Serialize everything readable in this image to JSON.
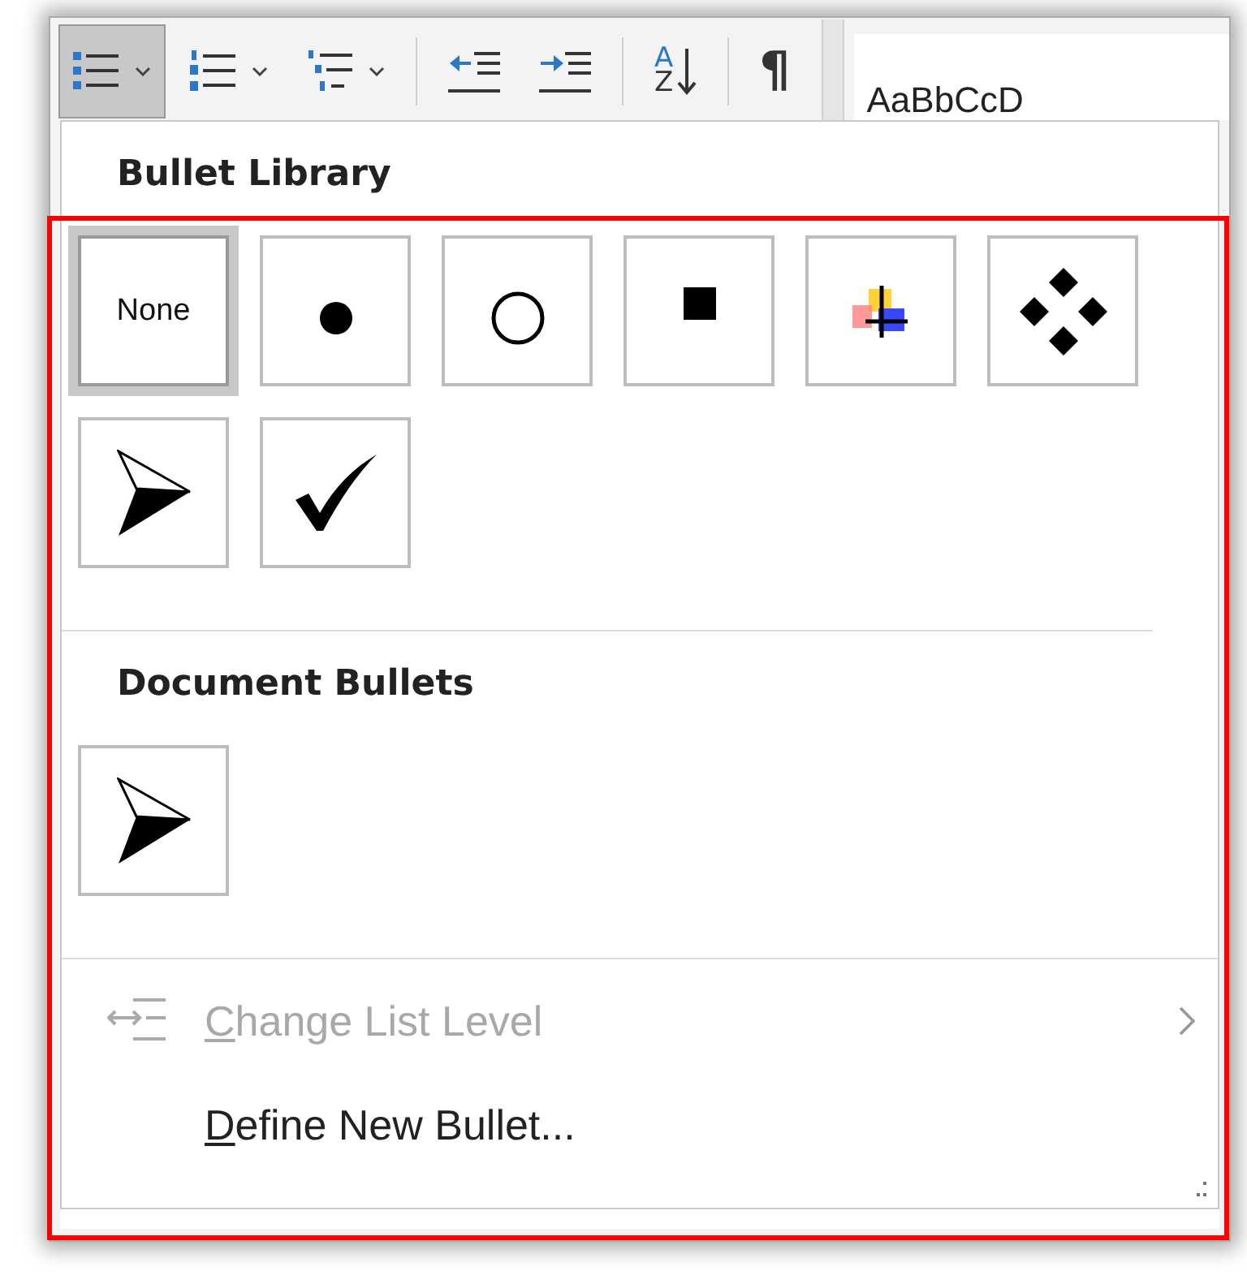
{
  "toolbar": {
    "buttons": [
      {
        "kind": "bullets",
        "selected": true,
        "dropdown": true
      },
      {
        "kind": "numbering",
        "selected": false,
        "dropdown": true
      },
      {
        "kind": "multilevel",
        "selected": false,
        "dropdown": true
      },
      {
        "kind": "decrease-indent",
        "selected": false,
        "dropdown": false
      },
      {
        "kind": "increase-indent",
        "selected": false,
        "dropdown": false
      },
      {
        "kind": "sort",
        "selected": false,
        "dropdown": false,
        "letters": [
          "A",
          "Z"
        ]
      },
      {
        "kind": "pilcrow",
        "selected": false,
        "dropdown": false,
        "glyph": "¶"
      }
    ],
    "style_preview": "AaBbCcD"
  },
  "menu": {
    "sections": [
      {
        "title": "Bullet Library",
        "bullets": [
          {
            "kind": "none",
            "label": "None",
            "selected": true
          },
          {
            "kind": "dot",
            "selected": false
          },
          {
            "kind": "circle",
            "selected": false
          },
          {
            "kind": "square",
            "selected": false
          },
          {
            "kind": "picture",
            "selected": false
          },
          {
            "kind": "diamonds",
            "selected": false
          },
          {
            "kind": "arrow",
            "selected": false
          },
          {
            "kind": "check",
            "selected": false
          }
        ]
      },
      {
        "title": "Document Bullets",
        "bullets": [
          {
            "kind": "arrow",
            "selected": false
          }
        ]
      }
    ],
    "commands": [
      {
        "kind": "list-level",
        "label": "Change List Level",
        "disabled": true,
        "submenu": true,
        "underline_first": true
      },
      {
        "kind": "define",
        "label": "Define New Bullet...",
        "disabled": false,
        "submenu": false,
        "underline_first": true
      }
    ]
  },
  "highlight": {
    "color": "#ff0000"
  }
}
